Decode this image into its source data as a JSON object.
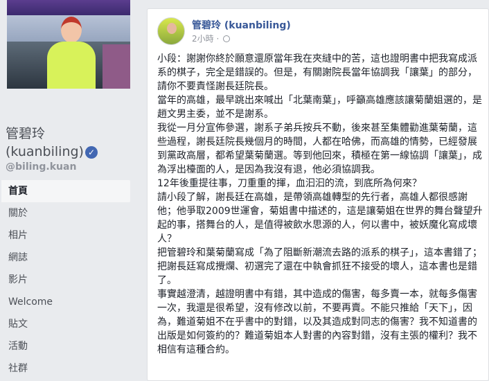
{
  "page": {
    "name_line1": "管碧玲",
    "name_line2": "(kuanbiling)",
    "handle": "@biling.kuan"
  },
  "nav": {
    "items": [
      {
        "label": "首頁"
      },
      {
        "label": "關於"
      },
      {
        "label": "相片"
      },
      {
        "label": "網誌"
      },
      {
        "label": "影片"
      },
      {
        "label": "Welcome"
      },
      {
        "label": "貼文"
      },
      {
        "label": "活動"
      },
      {
        "label": "社群"
      }
    ]
  },
  "post": {
    "author": "管碧玲 (kuanbiling)",
    "time": "2小時",
    "paragraphs": [
      "小段：謝謝你終於願意還原當年我在夾縫中的苦，這也證明書中把我寫成派系的棋子，完全是錯誤的。但是，有關謝院長當年協調我「讓葉」的部分，請你不要責怪謝長廷院長。",
      "當年的高雄，最早跳出來喊出「北葉南葉」，呼籲高雄應該讓菊蘭姐選的，是趙文男主委，並不是謝系。",
      "我從一月分宣佈參選，謝系子弟兵按兵不動，後來甚至集體勸進葉菊蘭，這些過程，謝長廷院長幾個月的時間，人都在哈佛，而高雄的情勢，已經發展到黨政高層，都希望葉菊蘭選。等到他回來，積極在第一線協調「讓葉」，成為浮出檯面的人，是因為我沒有退，他必須協調我。",
      "12年後重提往事，刀重重的揮，血汩汩的流，到底所為何來？",
      "請小段了解，謝長廷在高雄，是帶領高雄轉型的先行者，高雄人都很感謝他；他爭取2009世運會，菊姐書中描述的，這是讓菊姐在世界的舞台聲望升起的事，搭舞台的人，是值得被飲水思源的人，何以書中，被妖魔化寫成壞人？",
      "把管碧玲和葉菊蘭寫成「為了阻斷新潮流去路的派系的棋子」，這本書錯了；把謝長廷寫成攪爛、初選完了還在中執會抓狂不接受的壞人，這本書也是錯了。",
      "事實越澄清，越證明書中有錯，其中造成的傷害，每多賣一本，就每多傷害一次，我還是很希望，沒有修改以前，不要再賣。不能只推給「天下」，因為，難道菊姐不在乎書中的對錯，以及其造成對同志的傷害？我不知道書的出版是如何簽約的？難道菊姐本人對書的內容對錯，沒有主張的權利？我不相信有這種合約。"
    ]
  }
}
